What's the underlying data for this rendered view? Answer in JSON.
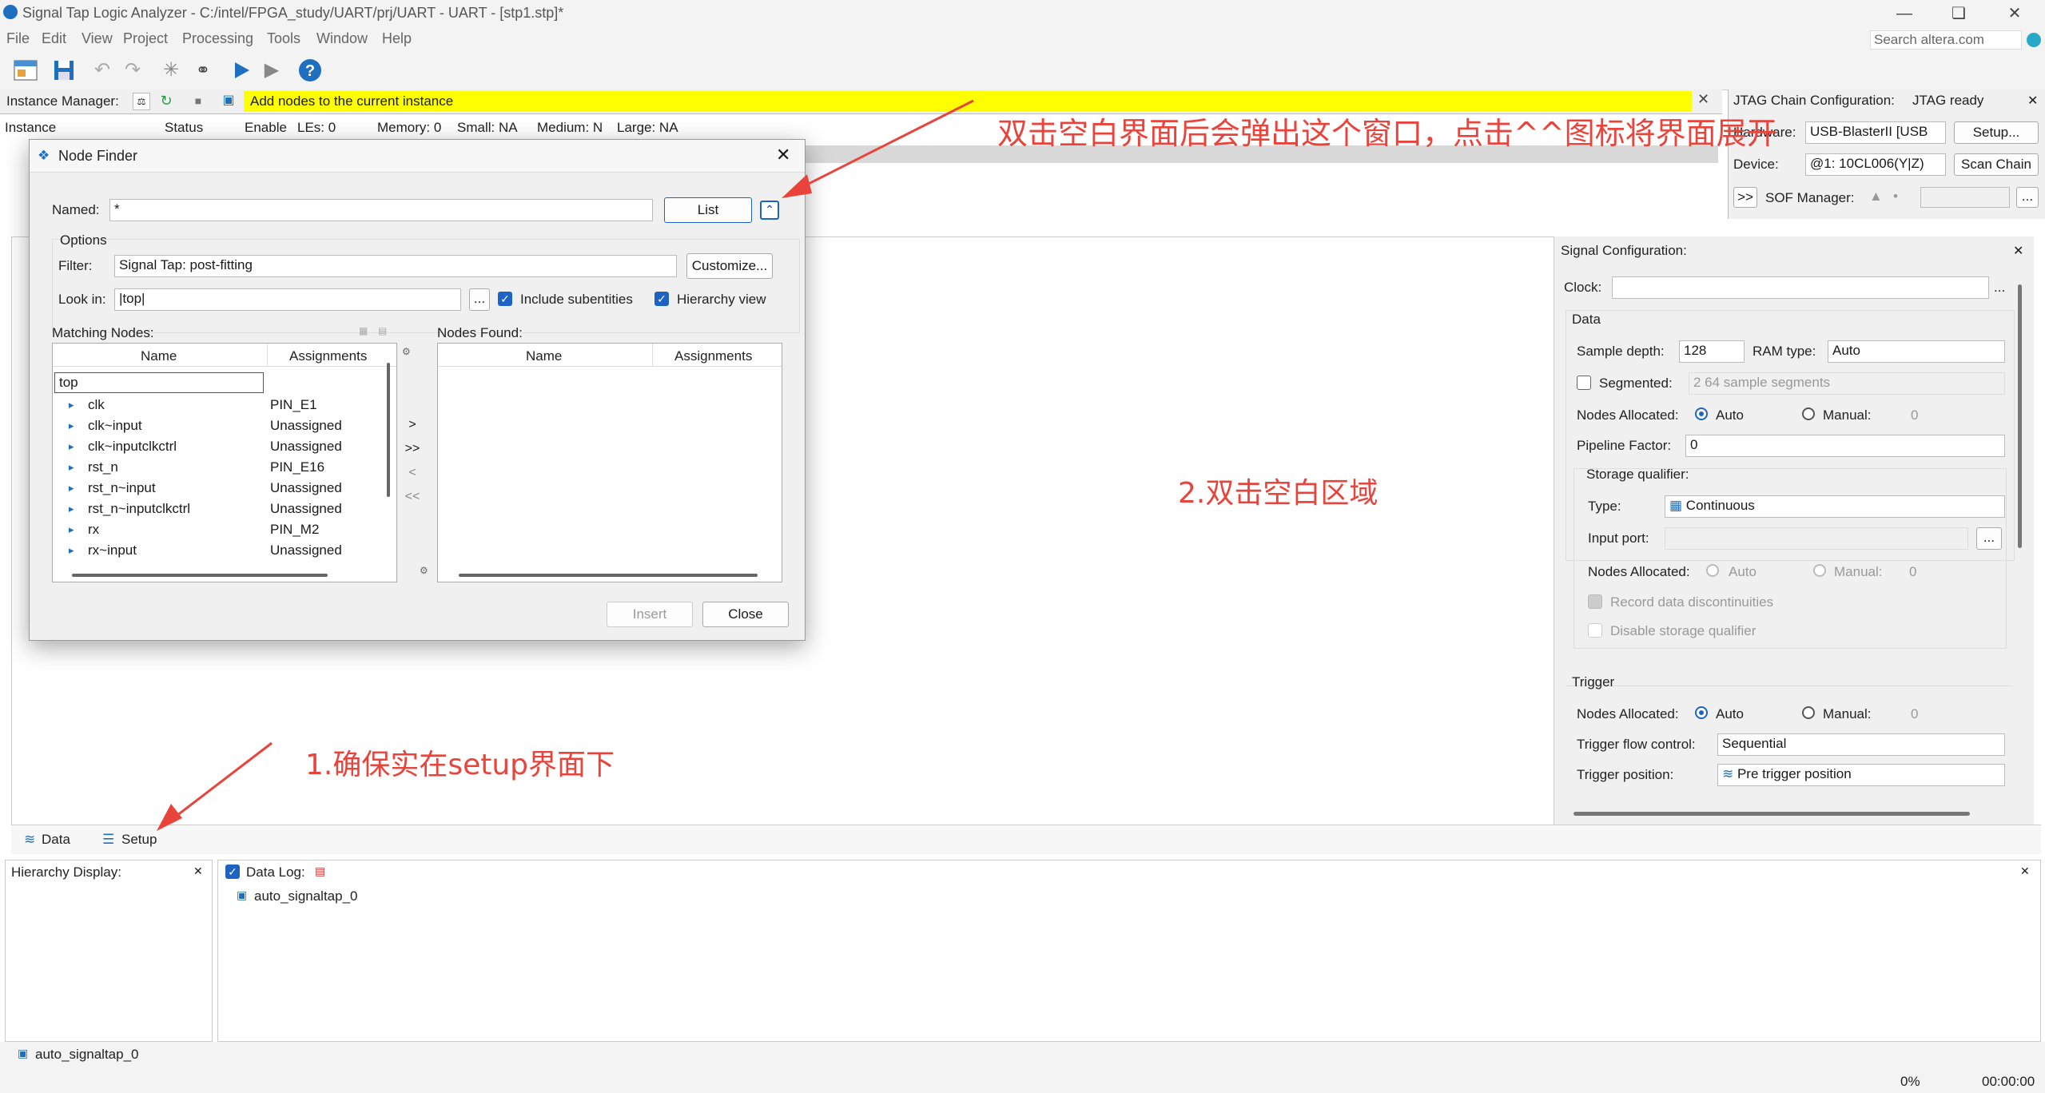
{
  "window": {
    "title": "Signal Tap Logic Analyzer - C:/intel/FPGA_study/UART/prj/UART - UART - [stp1.stp]*"
  },
  "menu": [
    "File",
    "Edit",
    "View",
    "Project",
    "Processing",
    "Tools",
    "Window",
    "Help"
  ],
  "search": {
    "placeholder": "Search altera.com"
  },
  "instance_manager": {
    "label": "Instance Manager:",
    "message": "Add nodes to the current instance",
    "columns": [
      "Instance",
      "Status",
      "Enable",
      "LEs: 0",
      "Memory: 0",
      "Small: NA",
      "Medium: N",
      "Large: NA"
    ]
  },
  "jtag": {
    "title": "JTAG Chain Configuration:",
    "status": "JTAG ready",
    "hardware_label": "Hardware:",
    "hardware_value": "USB-BlasterII [USB",
    "setup_btn": "Setup...",
    "device_label": "Device:",
    "device_value": "@1: 10CL006(Y|Z)",
    "scan_btn": "Scan Chain",
    "more_btn": ">>",
    "sof_label": "SOF Manager:",
    "dots": "..."
  },
  "node_finder": {
    "title": "Node Finder",
    "named_label": "Named:",
    "named_value": "*",
    "list_btn": "List",
    "options_label": "Options",
    "filter_label": "Filter:",
    "filter_value": "Signal Tap: post-fitting",
    "customize_btn": "Customize...",
    "lookin_label": "Look in:",
    "lookin_value": "|top|",
    "browse_btn": "...",
    "include_sub": "Include subentities",
    "hierarchy_view": "Hierarchy view",
    "matching_label": "Matching Nodes:",
    "found_label": "Nodes Found:",
    "col_name": "Name",
    "col_assign": "Assignments",
    "tree_root": "top",
    "nodes": [
      {
        "name": "clk",
        "assign": "PIN_E1"
      },
      {
        "name": "clk~input",
        "assign": "Unassigned"
      },
      {
        "name": "clk~inputclkctrl",
        "assign": "Unassigned"
      },
      {
        "name": "rst_n",
        "assign": "PIN_E16"
      },
      {
        "name": "rst_n~input",
        "assign": "Unassigned"
      },
      {
        "name": "rst_n~inputclkctrl",
        "assign": "Unassigned"
      },
      {
        "name": "rx",
        "assign": "PIN_M2"
      },
      {
        "name": "rx~input",
        "assign": "Unassigned"
      }
    ],
    "move_one": ">",
    "move_all": ">>",
    "remove_one": "<",
    "remove_all": "<<",
    "insert_btn": "Insert",
    "close_btn": "Close"
  },
  "signal_config": {
    "title": "Signal Configuration:",
    "clock_label": "Clock:",
    "clock_btn": "...",
    "data_label": "Data",
    "sample_depth_label": "Sample depth:",
    "sample_depth": "128",
    "ram_type_label": "RAM type:",
    "ram_type": "Auto",
    "segmented_label": "Segmented:",
    "segmented_value": "2  64 sample segments",
    "nodes_alloc_label": "Nodes Allocated:",
    "auto": "Auto",
    "manual": "Manual:",
    "zero": "0",
    "pipeline_label": "Pipeline Factor:",
    "pipeline_value": "0",
    "storage_label": "Storage qualifier:",
    "type_label": "Type:",
    "type_value": "Continuous",
    "input_port_label": "Input port:",
    "input_port_btn": "...",
    "record_label": "Record data discontinuities",
    "disable_label": "Disable storage qualifier",
    "trigger_label": "Trigger",
    "flow_label": "Trigger flow control:",
    "flow_value": "Sequential",
    "position_label": "Trigger position:",
    "position_value": "Pre trigger position"
  },
  "tabs": [
    "Data",
    "Setup"
  ],
  "hierarchy_display": {
    "title": "Hierarchy Display:"
  },
  "data_log": {
    "title": "Data Log:",
    "item": "auto_signaltap_0"
  },
  "statusbar": {
    "item": "auto_signaltap_0",
    "percent": "0%",
    "time": "00:00:00"
  },
  "annotations": {
    "a1": "双击空白界面后会弹出这个窗口，点击^^图标将界面展开",
    "a2": "2.双击空白区域",
    "a3": "1.确保实在setup界面下"
  },
  "colors": {
    "annotation": "#e8443c",
    "highlight": "#ffff00",
    "accent": "#1e63c4"
  }
}
